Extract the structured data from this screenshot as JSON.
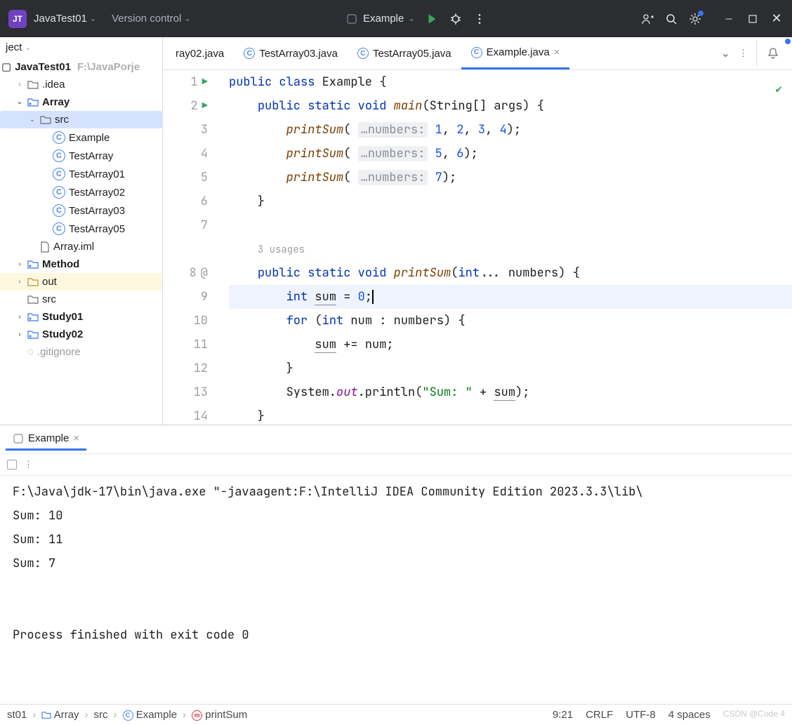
{
  "titlebar": {
    "project_icon": "JT",
    "project_name": "JavaTest01",
    "vc_label": "Version control",
    "run_config": "Example"
  },
  "left_panel": {
    "header": "ject",
    "project_root": "JavaTest01",
    "project_path": "F:\\JavaPorje",
    "tree": [
      {
        "label": ".idea",
        "icon": "folder",
        "indent": 1,
        "arrow": ">"
      },
      {
        "label": "Array",
        "icon": "module",
        "indent": 1,
        "arrow": "v",
        "bold": true
      },
      {
        "label": "src",
        "icon": "folder",
        "indent": 2,
        "arrow": "v",
        "selected": true
      },
      {
        "label": "Example",
        "icon": "class",
        "indent": 3
      },
      {
        "label": "TestArray",
        "icon": "class",
        "indent": 3
      },
      {
        "label": "TestArray01",
        "icon": "class",
        "indent": 3
      },
      {
        "label": "TestArray02",
        "icon": "class",
        "indent": 3
      },
      {
        "label": "TestArray03",
        "icon": "class",
        "indent": 3
      },
      {
        "label": "TestArray05",
        "icon": "class",
        "indent": 3
      },
      {
        "label": "Array.iml",
        "icon": "file",
        "indent": 2
      },
      {
        "label": "Method",
        "icon": "module",
        "indent": 1,
        "arrow": ">",
        "bold": true
      },
      {
        "label": "out",
        "icon": "folder-out",
        "indent": 1,
        "arrow": ">",
        "out": true
      },
      {
        "label": "src",
        "icon": "folder",
        "indent": 1
      },
      {
        "label": "Study01",
        "icon": "module",
        "indent": 1,
        "arrow": ">",
        "bold": true
      },
      {
        "label": "Study02",
        "icon": "module",
        "indent": 1,
        "arrow": ">",
        "bold": true
      },
      {
        "label": ".gitignore",
        "icon": "git",
        "indent": 1,
        "dim": true
      }
    ]
  },
  "tabs": [
    {
      "label": "ray02.java",
      "active": false,
      "truncated": true
    },
    {
      "label": "TestArray03.java",
      "active": false
    },
    {
      "label": "TestArray05.java",
      "active": false
    },
    {
      "label": "Example.java",
      "active": true,
      "closable": true
    }
  ],
  "code": {
    "usages_hint": "3 usages",
    "param_hint": "…numbers:",
    "lines": [
      {
        "n": 1,
        "run": true,
        "tokens": [
          [
            "kw",
            "public"
          ],
          [
            "",
            ""
          ],
          [
            "kw",
            " class"
          ],
          [
            "",
            " Example {"
          ]
        ]
      },
      {
        "n": 2,
        "run": true,
        "tokens": [
          [
            "",
            "    "
          ],
          [
            "kw",
            "public"
          ],
          [
            "kw",
            " static"
          ],
          [
            "kw",
            " void"
          ],
          [
            "",
            " "
          ],
          [
            "fn",
            "main"
          ],
          [
            "",
            "(String[] args) {"
          ]
        ]
      },
      {
        "n": 3,
        "tokens": [
          [
            "",
            "        "
          ],
          [
            "fn",
            "printSum"
          ],
          [
            "",
            "( "
          ],
          [
            "hint",
            "…numbers:"
          ],
          [
            "",
            " "
          ],
          [
            "num",
            "1"
          ],
          [
            "",
            ", "
          ],
          [
            "num",
            "2"
          ],
          [
            "",
            ", "
          ],
          [
            "num",
            "3"
          ],
          [
            "",
            ", "
          ],
          [
            "num",
            "4"
          ],
          [
            "",
            ");"
          ]
        ]
      },
      {
        "n": 4,
        "tokens": [
          [
            "",
            "        "
          ],
          [
            "fn",
            "printSum"
          ],
          [
            "",
            "( "
          ],
          [
            "hint",
            "…numbers:"
          ],
          [
            "",
            " "
          ],
          [
            "num",
            "5"
          ],
          [
            "",
            ", "
          ],
          [
            "num",
            "6"
          ],
          [
            "",
            ");"
          ]
        ]
      },
      {
        "n": 5,
        "tokens": [
          [
            "",
            "        "
          ],
          [
            "fn",
            "printSum"
          ],
          [
            "",
            "( "
          ],
          [
            "hint",
            "…numbers:"
          ],
          [
            "",
            " "
          ],
          [
            "num",
            "7"
          ],
          [
            "",
            ");"
          ]
        ]
      },
      {
        "n": 6,
        "tokens": [
          [
            "",
            "    }"
          ]
        ]
      },
      {
        "n": 7,
        "tokens": [
          [
            "",
            ""
          ]
        ]
      },
      {
        "n": 0,
        "usages": true
      },
      {
        "n": 8,
        "at": true,
        "tokens": [
          [
            "",
            "    "
          ],
          [
            "kw",
            "public"
          ],
          [
            "kw",
            " static"
          ],
          [
            "kw",
            " void"
          ],
          [
            "",
            " "
          ],
          [
            "fn",
            "printSum"
          ],
          [
            "",
            "("
          ],
          [
            "kw",
            "int"
          ],
          [
            "",
            "... numbers) {"
          ]
        ]
      },
      {
        "n": 9,
        "hl": true,
        "tokens": [
          [
            "",
            "        "
          ],
          [
            "kw",
            "int"
          ],
          [
            "",
            " "
          ],
          [
            "ul",
            "sum"
          ],
          [
            "",
            " = "
          ],
          [
            "num",
            "0"
          ],
          [
            "",
            ";"
          ],
          [
            "cursor",
            ""
          ]
        ]
      },
      {
        "n": 10,
        "tokens": [
          [
            "",
            "        "
          ],
          [
            "kw",
            "for"
          ],
          [
            "",
            " ("
          ],
          [
            "kw",
            "int"
          ],
          [
            "",
            " num : numbers) {"
          ]
        ]
      },
      {
        "n": 11,
        "tokens": [
          [
            "",
            "            "
          ],
          [
            "ul",
            "sum"
          ],
          [
            "",
            " += num;"
          ]
        ]
      },
      {
        "n": 12,
        "tokens": [
          [
            "",
            "        }"
          ]
        ]
      },
      {
        "n": 13,
        "tokens": [
          [
            "",
            "        System."
          ],
          [
            "field",
            "out"
          ],
          [
            "",
            ".println("
          ],
          [
            "str",
            "\"Sum: \""
          ],
          [
            "",
            " + "
          ],
          [
            "ul",
            "sum"
          ],
          [
            "",
            ");"
          ]
        ]
      },
      {
        "n": 14,
        "tokens": [
          [
            "",
            "    }"
          ]
        ]
      }
    ]
  },
  "bottom_panel": {
    "tab_label": "Example",
    "console": "F:\\Java\\jdk-17\\bin\\java.exe \"-javaagent:F:\\IntelliJ IDEA Community Edition 2023.3.3\\lib\\\nSum: 10\nSum: 11\nSum: 7\n\n\nProcess finished with exit code 0"
  },
  "statusbar": {
    "crumbs": [
      "st01",
      "Array",
      "src",
      "Example",
      "printSum"
    ],
    "crumb_icons": [
      "",
      "module",
      "",
      "class",
      "method"
    ],
    "pos": "9:21",
    "line_sep": "CRLF",
    "encoding": "UTF-8",
    "indent": "4 spaces",
    "watermark": "CSDN @Code 4"
  }
}
